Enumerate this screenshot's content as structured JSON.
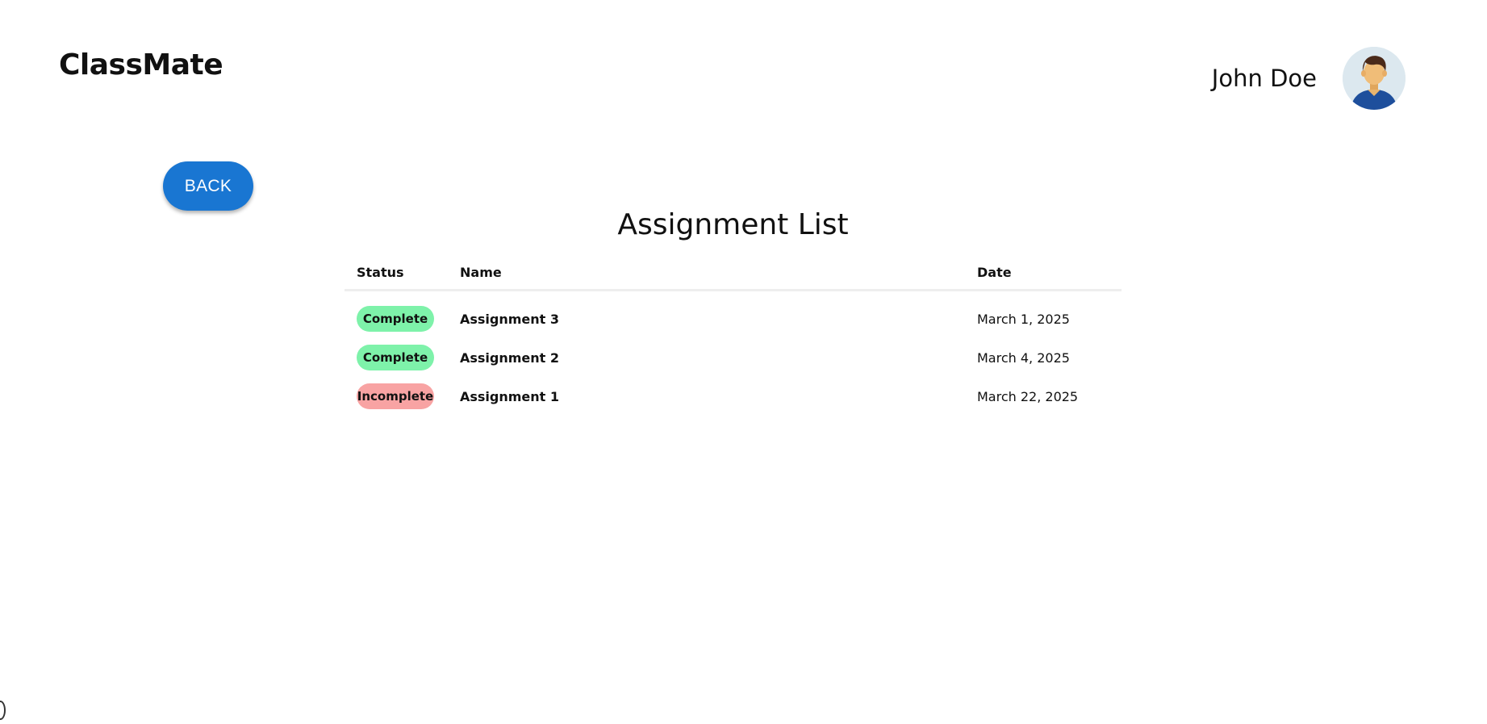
{
  "app": {
    "title": "ClassMate"
  },
  "user": {
    "name": "John Doe"
  },
  "back_button": {
    "label": "BACK"
  },
  "assignments": {
    "title": "Assignment List",
    "columns": {
      "status": "Status",
      "name": "Name",
      "date": "Date"
    },
    "rows": [
      {
        "status": "Complete",
        "status_color": "#7ef2aa",
        "name": "Assignment 3",
        "date": "March 1, 2025"
      },
      {
        "status": "Complete",
        "status_color": "#7ef2aa",
        "name": "Assignment 2",
        "date": "March 4, 2025"
      },
      {
        "status": "Incomplete",
        "status_color": "#f8a3a3",
        "name": "Assignment 1",
        "date": "March 22, 2025"
      }
    ]
  },
  "colors": {
    "accent": "#1976d2",
    "complete": "#7ef2aa",
    "incomplete": "#f8a3a3"
  },
  "icons": {
    "avatar": "user-avatar-icon"
  }
}
